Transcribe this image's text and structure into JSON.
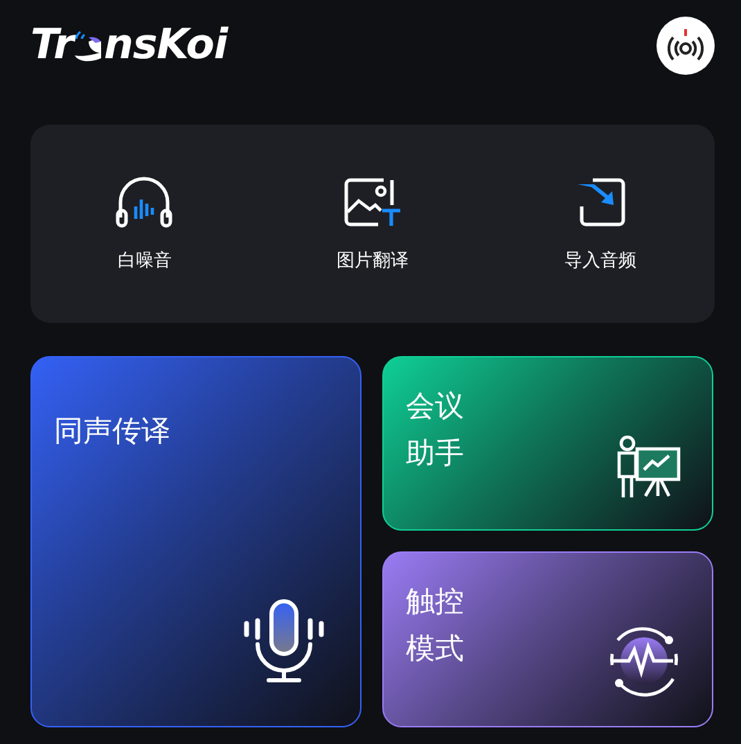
{
  "header": {
    "logo": {
      "before": "Tr",
      "after": "nsKoi"
    }
  },
  "tools": [
    {
      "label": "白噪音",
      "kind": "headphones"
    },
    {
      "label": "图片翻译",
      "kind": "image"
    },
    {
      "label": "导入音频",
      "kind": "import"
    }
  ],
  "cards": [
    {
      "lines": [
        "同声传译"
      ],
      "kind": "mic",
      "color": "#3461f5"
    },
    {
      "lines": [
        "会议",
        "助手"
      ],
      "kind": "meeting",
      "color": "#0fcf96"
    },
    {
      "lines": [
        "触控",
        "模式"
      ],
      "kind": "touch",
      "color": "#9a7cf4"
    }
  ]
}
